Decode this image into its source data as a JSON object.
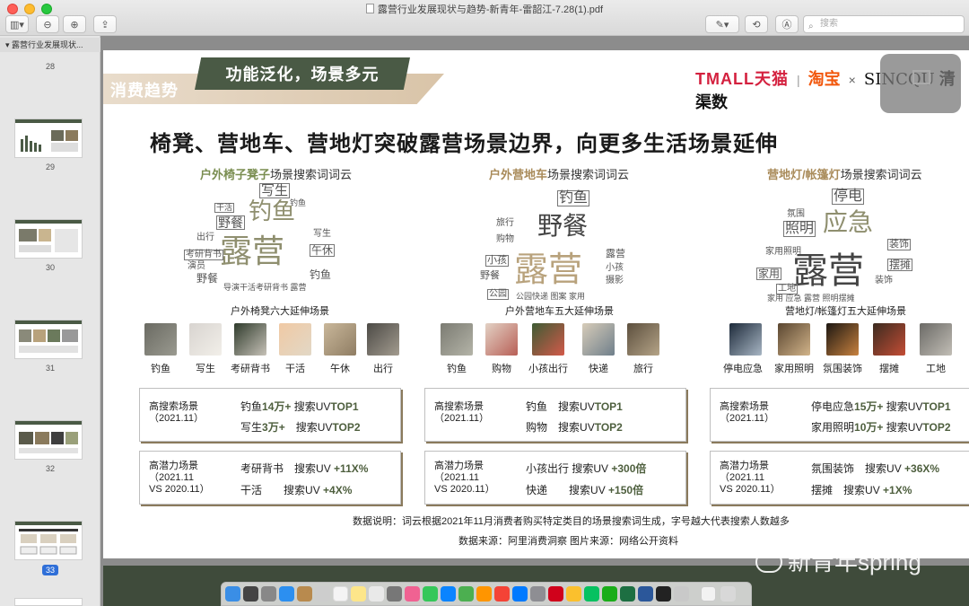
{
  "window": {
    "title": "露营行业发展现状与趋势-新青年-雷韶江-7.28(1).pdf",
    "search_placeholder": "搜索"
  },
  "sidebar": {
    "header": "露营行业发展现状...",
    "pages": [
      "28",
      "29",
      "30",
      "31",
      "32",
      "33"
    ],
    "current_page": "33"
  },
  "slide": {
    "section": "消费趋势",
    "banner": "功能泛化，场景多元",
    "brand": {
      "tmall": "TMALL天猫",
      "taobao": "淘宝",
      "x": "×",
      "sq": "SINCQU",
      "qq": "清渠数"
    },
    "heading": "椅凳、营地车、营地灯突破露营场景边界，向更多生活场景延伸",
    "columns": [
      {
        "title_hl": "户外椅子凳子",
        "title_rest": "场景搜索词词云",
        "subtitle": "户外椅凳六大延伸场景",
        "scenes": [
          "钓鱼",
          "写生",
          "考研背书",
          "干活",
          "午休",
          "出行"
        ],
        "card1": {
          "k1": "高搜索场景",
          "k2": "（2021.11）",
          "l1a": "钓鱼",
          "l1b": "14万+",
          "l1c": "搜索UV",
          "l1d": "TOP1",
          "l2a": "写生",
          "l2b": "3万+",
          "l2c": "搜索UV",
          "l2d": "TOP2"
        },
        "card2": {
          "k1": "高潜力场景",
          "k2": "（2021.11",
          "k3": "VS 2020.11）",
          "l1a": "考研背书",
          "l1c": "搜索UV",
          "l1d": "+11X%",
          "l2a": "干活",
          "l2c": "搜索UV",
          "l2d": "+4X%"
        }
      },
      {
        "title_hl": "户外营地车",
        "title_rest": "场景搜索词词云",
        "subtitle": "户外营地车五大延伸场景",
        "scenes": [
          "钓鱼",
          "购物",
          "小孩出行",
          "快递",
          "旅行"
        ],
        "card1": {
          "k1": "高搜索场景",
          "k2": "（2021.11）",
          "l1a": "钓鱼",
          "l1c": "搜索UV",
          "l1d": "TOP1",
          "l2a": "购物",
          "l2c": "搜索UV",
          "l2d": "TOP2"
        },
        "card2": {
          "k1": "高潜力场景",
          "k2": "（2021.11",
          "k3": "VS 2020.11）",
          "l1a": "小孩出行",
          "l1c": "搜索UV",
          "l1d": "+300倍",
          "l2a": "快递",
          "l2c": "搜索UV",
          "l2d": "+150倍"
        }
      },
      {
        "title_hl": "营地灯/帐篷灯",
        "title_rest": "场景搜索词词云",
        "subtitle": "营地灯/帐篷灯五大延伸场景",
        "scenes": [
          "停电应急",
          "家用照明",
          "氛围装饰",
          "摆摊",
          "工地"
        ],
        "card1": {
          "k1": "高搜索场景",
          "k2": "（2021.11）",
          "l1a": "停电应急",
          "l1b": "15万+",
          "l1c": "搜索UV",
          "l1d": "TOP1",
          "l2a": "家用照明",
          "l2b": "10万+",
          "l2c": "搜索UV",
          "l2d": "TOP2"
        },
        "card2": {
          "k1": "高潜力场景",
          "k2": "（2021.11",
          "k3": "VS 2020.11）",
          "l1a": "氛围装饰",
          "l1c": "搜索UV",
          "l1d": "+36X%",
          "l2a": "摆摊",
          "l2c": "搜索UV",
          "l2d": "+1X%"
        }
      }
    ],
    "footnote1": "数据说明：词云根据2021年11月消费者购买特定类目的场景搜索词生成，字号越大代表搜索人数越多",
    "footnote2": "数据来源：阿里消费洞察   图片来源：网络公开资料"
  },
  "watermark": "新青年spring"
}
